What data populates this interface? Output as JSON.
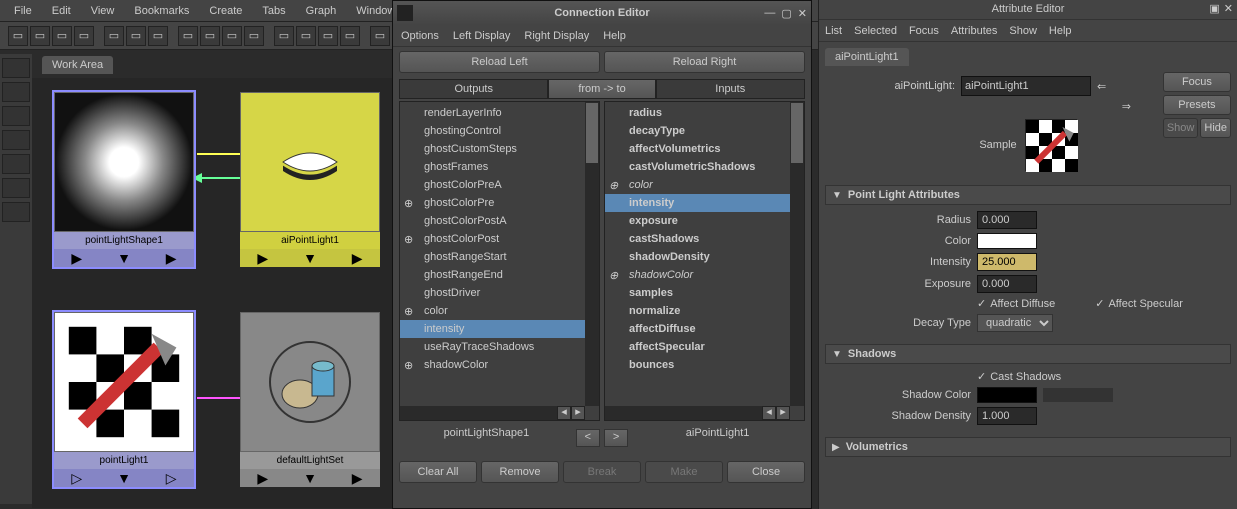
{
  "main_menu": {
    "file": "File",
    "edit": "Edit",
    "view": "View",
    "bookmarks": "Bookmarks",
    "create": "Create",
    "tabs": "Tabs",
    "graph": "Graph",
    "window": "Window"
  },
  "workarea_tab": "Work Area",
  "nodes": {
    "pointLightShape1": "pointLightShape1",
    "aiPointLight1": "aiPointLight1",
    "pointLight1": "pointLight1",
    "defaultLightSet": "defaultLightSet"
  },
  "conn": {
    "title": "Connection Editor",
    "menu": {
      "options": "Options",
      "left": "Left Display",
      "right": "Right Display",
      "help": "Help"
    },
    "reload_left": "Reload Left",
    "reload_right": "Reload Right",
    "hdr_outputs": "Outputs",
    "hdr_from": "from -> to",
    "hdr_inputs": "Inputs",
    "left_name": "pointLightShape1",
    "right_name": "aiPointLight1",
    "clear": "Clear All",
    "remove": "Remove",
    "break": "Break",
    "make": "Make",
    "close": "Close",
    "left_items": [
      {
        "t": "renderLayerInfo"
      },
      {
        "t": "ghostingControl"
      },
      {
        "t": "ghostCustomSteps"
      },
      {
        "t": "ghostFrames"
      },
      {
        "t": "ghostColorPreA"
      },
      {
        "t": "ghostColorPre",
        "exp": true
      },
      {
        "t": "ghostColorPostA"
      },
      {
        "t": "ghostColorPost",
        "exp": true
      },
      {
        "t": "ghostRangeStart"
      },
      {
        "t": "ghostRangeEnd"
      },
      {
        "t": "ghostDriver"
      },
      {
        "t": "color",
        "exp": true
      },
      {
        "t": "intensity",
        "sel": true
      },
      {
        "t": "useRayTraceShadows"
      },
      {
        "t": "shadowColor",
        "exp": true
      }
    ],
    "right_items": [
      {
        "t": "radius"
      },
      {
        "t": "decayType"
      },
      {
        "t": "affectVolumetrics"
      },
      {
        "t": "castVolumetricShadows"
      },
      {
        "t": "color",
        "exp": true,
        "muted": true
      },
      {
        "t": "intensity",
        "sel": true
      },
      {
        "t": "exposure"
      },
      {
        "t": "castShadows"
      },
      {
        "t": "shadowDensity"
      },
      {
        "t": "shadowColor",
        "exp": true,
        "muted": true
      },
      {
        "t": "samples"
      },
      {
        "t": "normalize"
      },
      {
        "t": "affectDiffuse"
      },
      {
        "t": "affectSpecular"
      },
      {
        "t": "bounces"
      }
    ]
  },
  "attr": {
    "title": "Attribute Editor",
    "menu": {
      "list": "List",
      "selected": "Selected",
      "focus": "Focus",
      "attributes": "Attributes",
      "show": "Show",
      "help": "Help"
    },
    "tab": "aiPointLight1",
    "type_label": "aiPointLight:",
    "name": "aiPointLight1",
    "btns": {
      "focus": "Focus",
      "presets": "Presets",
      "show": "Show",
      "hide": "Hide"
    },
    "sample_label": "Sample",
    "sec_pla": "Point Light Attributes",
    "radius_l": "Radius",
    "radius_v": "0.000",
    "color_l": "Color",
    "intensity_l": "Intensity",
    "intensity_v": "25.000",
    "exposure_l": "Exposure",
    "exposure_v": "0.000",
    "aff_diff": "Affect Diffuse",
    "aff_spec": "Affect Specular",
    "decay_l": "Decay Type",
    "decay_v": "quadratic",
    "sec_shadows": "Shadows",
    "cast_sh": "Cast Shadows",
    "sh_color_l": "Shadow Color",
    "sh_dens_l": "Shadow Density",
    "sh_dens_v": "1.000",
    "sec_vol": "Volumetrics"
  }
}
